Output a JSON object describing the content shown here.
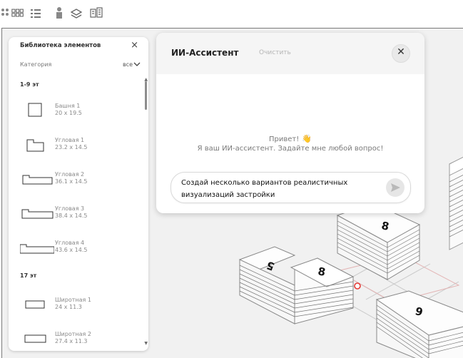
{
  "library": {
    "title": "Библиотека элементов",
    "category_label": "Категория",
    "category_value": "все",
    "sections": [
      {
        "heading": "1-9 эт",
        "items": [
          {
            "name": "Башня 1",
            "dims": "20 x 19.5"
          },
          {
            "name": "Угловая 1",
            "dims": "23.2 x 14.5"
          },
          {
            "name": "Угловая 2",
            "dims": "36.1 x 14.5"
          },
          {
            "name": "Угловая 3",
            "dims": "38.4 x 14.5"
          },
          {
            "name": "Угловая 4",
            "dims": "43.6 x 14.5"
          }
        ]
      },
      {
        "heading": "17 эт",
        "items": [
          {
            "name": "Широтная 1",
            "dims": "24 x 11.3"
          },
          {
            "name": "Широтная 2",
            "dims": "27.4 x 11.3"
          }
        ]
      }
    ]
  },
  "assistant": {
    "title": "ИИ-Ассистент",
    "clear_label": "Очистить",
    "greeting_line1": "Привет!",
    "greeting_emoji": "👋",
    "greeting_line2": "Я ваш ИИ-ассистент. Задайте мне любой вопрос!",
    "input_value": "Создай несколько вариантов реалистичных визуализаций застройки"
  },
  "scene": {
    "building_labels": [
      "8",
      "5",
      "8",
      "9"
    ]
  },
  "colors": {
    "accent": "#e53935",
    "panel": "#ffffff",
    "workspace": "#f1f1f1"
  }
}
